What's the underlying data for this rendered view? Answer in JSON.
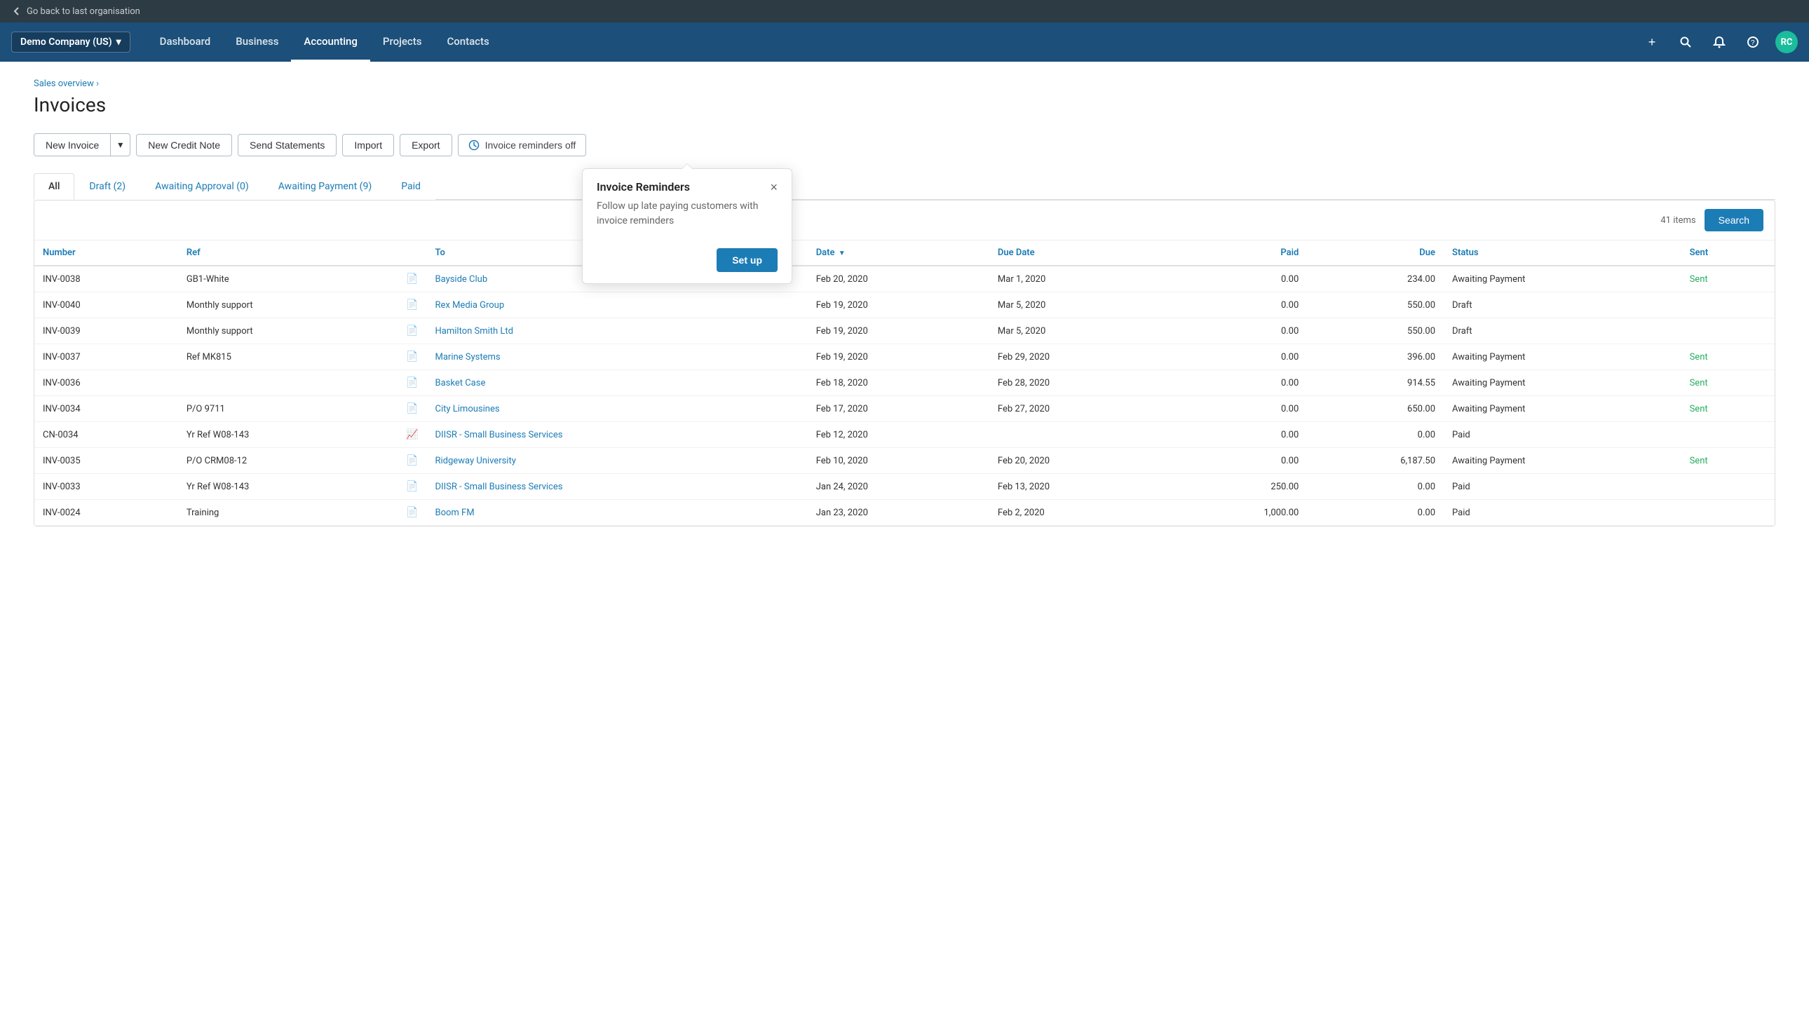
{
  "topbar": {
    "back_label": "Go back to last organisation"
  },
  "nav": {
    "company": "Demo Company (US)",
    "links": [
      {
        "label": "Dashboard",
        "active": false
      },
      {
        "label": "Business",
        "active": false
      },
      {
        "label": "Accounting",
        "active": true
      },
      {
        "label": "Projects",
        "active": false
      },
      {
        "label": "Contacts",
        "active": false
      }
    ],
    "avatar": "RC"
  },
  "breadcrumb": "Sales overview ›",
  "page_title": "Invoices",
  "toolbar": {
    "new_invoice": "New Invoice",
    "new_credit_note": "New Credit Note",
    "send_statements": "Send Statements",
    "import": "Import",
    "export": "Export",
    "reminders": "Invoice reminders off"
  },
  "tabs": [
    {
      "label": "All",
      "active": true
    },
    {
      "label": "Draft",
      "count": "(2)",
      "active": false
    },
    {
      "label": "Awaiting Approval",
      "count": "(0)",
      "active": false
    },
    {
      "label": "Awaiting Payment",
      "count": "(9)",
      "active": false
    },
    {
      "label": "Paid",
      "active": false
    }
  ],
  "table": {
    "items_count": "41 items",
    "search_label": "Search",
    "columns": [
      "Number",
      "Ref",
      "To",
      "Date",
      "Due Date",
      "Paid",
      "Due",
      "Status",
      "Sent"
    ],
    "rows": [
      {
        "number": "INV-0038",
        "ref": "GB1-White",
        "icon": "doc",
        "to": "Bayside Club",
        "date": "Feb 20, 2020",
        "due_date": "Mar 1, 2020",
        "paid": "0.00",
        "due": "234.00",
        "status": "Awaiting Payment",
        "sent": "Sent"
      },
      {
        "number": "INV-0040",
        "ref": "Monthly support",
        "icon": "doc",
        "to": "Rex Media Group",
        "date": "Feb 19, 2020",
        "due_date": "Mar 5, 2020",
        "paid": "0.00",
        "due": "550.00",
        "status": "Draft",
        "sent": ""
      },
      {
        "number": "INV-0039",
        "ref": "Monthly support",
        "icon": "doc",
        "to": "Hamilton Smith Ltd",
        "date": "Feb 19, 2020",
        "due_date": "Mar 5, 2020",
        "paid": "0.00",
        "due": "550.00",
        "status": "Draft",
        "sent": ""
      },
      {
        "number": "INV-0037",
        "ref": "Ref MK815",
        "icon": "doc",
        "to": "Marine Systems",
        "date": "Feb 19, 2020",
        "due_date": "Feb 29, 2020",
        "paid": "0.00",
        "due": "396.00",
        "status": "Awaiting Payment",
        "sent": "Sent"
      },
      {
        "number": "INV-0036",
        "ref": "",
        "icon": "doc",
        "to": "Basket Case",
        "date": "Feb 18, 2020",
        "due_date": "Feb 28, 2020",
        "paid": "0.00",
        "due": "914.55",
        "status": "Awaiting Payment",
        "sent": "Sent"
      },
      {
        "number": "INV-0034",
        "ref": "P/O 9711",
        "icon": "doc",
        "to": "City Limousines",
        "date": "Feb 17, 2020",
        "due_date": "Feb 27, 2020",
        "paid": "0.00",
        "due": "650.00",
        "status": "Awaiting Payment",
        "sent": "Sent"
      },
      {
        "number": "CN-0034",
        "ref": "Yr Ref W08-143",
        "icon": "credit",
        "to": "DIISR - Small Business Services",
        "date": "Feb 12, 2020",
        "due_date": "",
        "paid": "0.00",
        "due": "0.00",
        "status": "Paid",
        "sent": ""
      },
      {
        "number": "INV-0035",
        "ref": "P/O CRM08-12",
        "icon": "doc",
        "to": "Ridgeway University",
        "date": "Feb 10, 2020",
        "due_date": "Feb 20, 2020",
        "paid": "0.00",
        "due": "6,187.50",
        "status": "Awaiting Payment",
        "sent": "Sent"
      },
      {
        "number": "INV-0033",
        "ref": "Yr Ref W08-143",
        "icon": "doc-yellow",
        "to": "DIISR - Small Business Services",
        "date": "Jan 24, 2020",
        "due_date": "Feb 13, 2020",
        "paid": "250.00",
        "due": "0.00",
        "status": "Paid",
        "sent": ""
      },
      {
        "number": "INV-0024",
        "ref": "Training",
        "icon": "doc",
        "to": "Boom FM",
        "date": "Jan 23, 2020",
        "due_date": "Feb 2, 2020",
        "paid": "1,000.00",
        "due": "0.00",
        "status": "Paid",
        "sent": ""
      }
    ]
  },
  "popup": {
    "title": "Invoice Reminders",
    "body": "Follow up late paying customers with invoice reminders",
    "setup_label": "Set up",
    "close_label": "×"
  }
}
